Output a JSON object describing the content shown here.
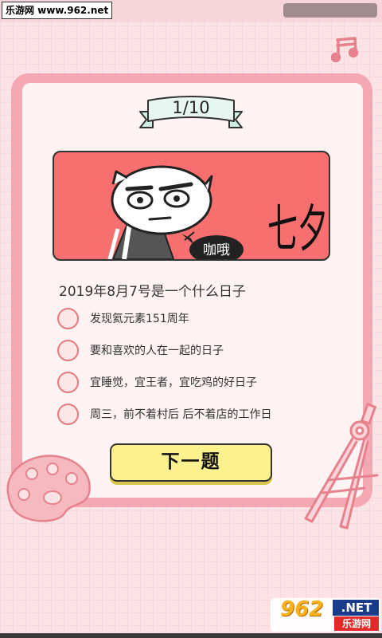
{
  "watermark": {
    "top": "乐游网 www.962.net",
    "num": "962",
    "net": ".NET",
    "cn": "乐游网"
  },
  "quiz": {
    "counter": "1/10",
    "illustration_text": {
      "bubble": "咖哦",
      "big": "七夕"
    },
    "question": "2019年8月7号是一个什么日子",
    "options": [
      {
        "label": "发现氦元素151周年"
      },
      {
        "label": "要和喜欢的人在一起的日子"
      },
      {
        "label": "宜睡觉，宜王者，宜吃鸡的好日子"
      },
      {
        "label": "周三，前不着村后 后不着店的工作日"
      }
    ],
    "next_button": "下一题"
  },
  "icons": [
    "music-note-icon",
    "paint-palette-icon",
    "drafting-compass-icon"
  ],
  "colors": {
    "background": "#fbe3e6",
    "card_frame": "#f3a8b3",
    "card_inner": "#fff3f4",
    "illustration_bg": "#f86f70",
    "radio_border": "#e7777f",
    "button_bg": "#fbf18f"
  }
}
